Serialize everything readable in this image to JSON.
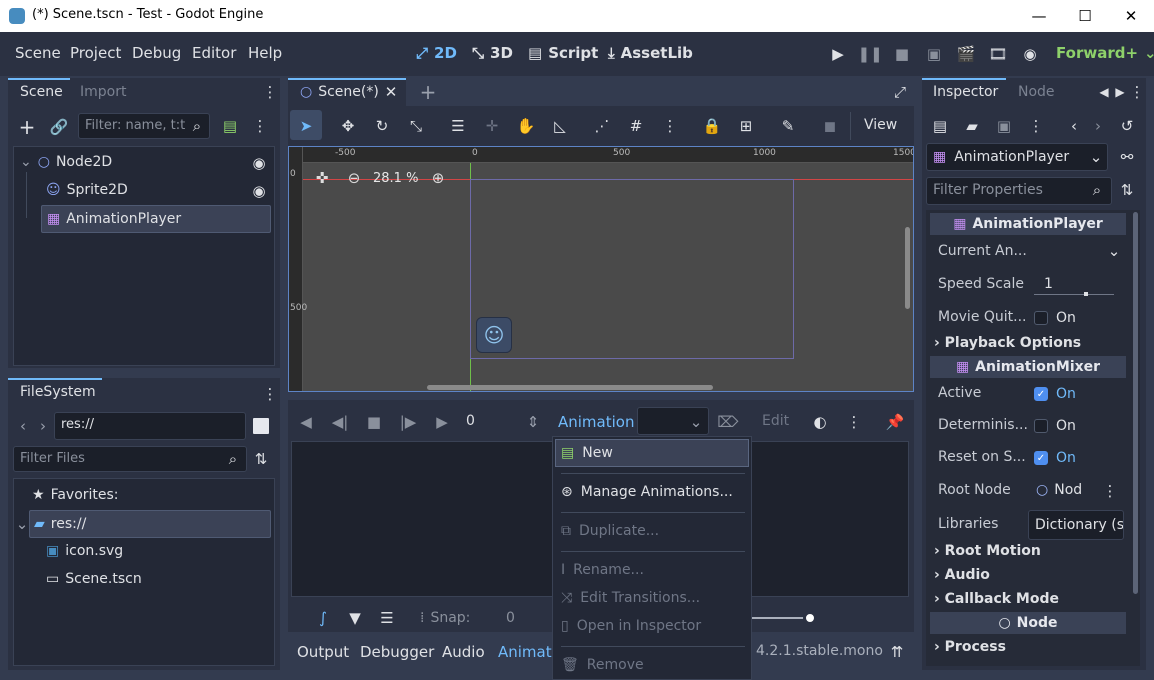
{
  "window": {
    "title": "(*) Scene.tscn - Test - Godot Engine",
    "minimize": "—",
    "maximize": "☐",
    "close": "✕"
  },
  "menu": [
    "Scene",
    "Project",
    "Debug",
    "Editor",
    "Help"
  ],
  "workspaces": [
    {
      "label": "2D",
      "icon": "2d-icon",
      "active": true
    },
    {
      "label": "3D",
      "icon": "3d-icon"
    },
    {
      "label": "Script",
      "icon": "script-icon"
    },
    {
      "label": "AssetLib",
      "icon": "assetlib-icon"
    }
  ],
  "renderer": "Forward+",
  "left_dock": {
    "tabs": [
      "Scene",
      "Import"
    ],
    "filter_placeholder": "Filter: name, t:t",
    "tree": [
      "Node2D",
      "Sprite2D",
      "AnimationPlayer"
    ]
  },
  "filesystem": {
    "tab": "FileSystem",
    "path": "res://",
    "filter_placeholder": "Filter Files",
    "items": [
      "Favorites:",
      "res://",
      "icon.svg",
      "Scene.tscn"
    ]
  },
  "scene_tab": {
    "label": "Scene(*)"
  },
  "toolbar": {
    "view_label": "View"
  },
  "viewport": {
    "zoom": "28.1 %",
    "ruler_labels": [
      "-500",
      "0",
      "500",
      "1000",
      "1500"
    ],
    "vertical_labels": [
      "0",
      "500"
    ]
  },
  "animation": {
    "frame": "0",
    "button_label": "Animation",
    "edit_label": "Edit",
    "snap_label": "Snap:",
    "snap_value": "0"
  },
  "popup_menu": [
    {
      "label": "New",
      "enabled": true,
      "icon": "new-icon"
    },
    {
      "label": "Manage Animations...",
      "enabled": true,
      "icon": "library-icon"
    },
    {
      "label": "Duplicate...",
      "enabled": false,
      "icon": "duplicate-icon"
    },
    {
      "label": "Rename...",
      "enabled": false,
      "icon": "rename-icon"
    },
    {
      "label": "Edit Transitions...",
      "enabled": false,
      "icon": "transition-icon"
    },
    {
      "label": "Open in Inspector",
      "enabled": false,
      "icon": "inspector-icon"
    },
    {
      "label": "Remove",
      "enabled": false,
      "icon": "trash-icon"
    }
  ],
  "bottom_tabs": [
    "Output",
    "Debugger",
    "Audio",
    "Animation"
  ],
  "version": "4.2.1.stable.mono",
  "inspector": {
    "tabs": [
      "Inspector",
      "Node"
    ],
    "node_selector": "AnimationPlayer",
    "filter_placeholder": "Filter Properties",
    "section1": "AnimationPlayer",
    "rows": {
      "current_animation": "Current An...",
      "speed_scale_label": "Speed Scale",
      "speed_scale_value": "1",
      "movie_quit_label": "Movie Quit...",
      "movie_quit_value": "On"
    },
    "playback_options": "Playback Options",
    "section2": "AnimationMixer",
    "mixer_rows": {
      "active_label": "Active",
      "active_value": "On",
      "deterministic_label": "Determinis...",
      "deterministic_value": "On",
      "reset_label": "Reset on S...",
      "reset_value": "On",
      "root_node_label": "Root Node",
      "root_node_value": "Nod",
      "libraries_label": "Libraries",
      "libraries_value": "Dictionary (s"
    },
    "groups": [
      "Root Motion",
      "Audio",
      "Callback Mode"
    ],
    "section3": "Node",
    "process": "Process"
  },
  "colors": {
    "accent": "#70bafa",
    "panel": "#2b3142",
    "background": "#333b4f",
    "menu_bg": "#232836",
    "viewport": "#4a4a4a"
  }
}
